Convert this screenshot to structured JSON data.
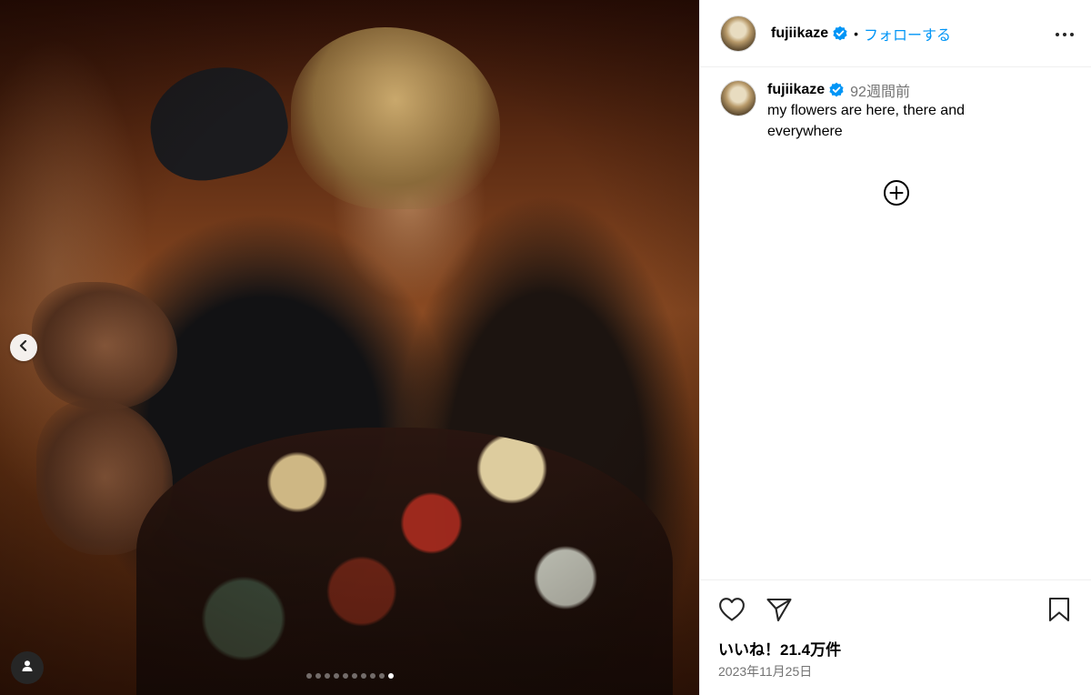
{
  "post": {
    "username": "fujiikaze",
    "follow_label": "フォローする",
    "separator": "•",
    "verified_icon": "verified-badge-icon",
    "more_icon": "more-options-icon"
  },
  "caption": {
    "username": "fujiikaze",
    "time_ago": "92週間前",
    "text": "my flowers are here, there and everywhere"
  },
  "carousel": {
    "dot_count": 10,
    "active_index": 9,
    "prev_icon": "chevron-left-icon",
    "user_tag_icon": "user-icon"
  },
  "actions": {
    "like_icon": "heart-icon",
    "share_icon": "paper-plane-icon",
    "save_icon": "bookmark-icon",
    "load_more_icon": "plus-circle-icon",
    "likes_text": "いいね！21.4万件",
    "date_text": "2023年11月25日"
  },
  "colors": {
    "accent_blue": "#0095f6",
    "secondary_text": "#737373",
    "border": "#efefef"
  }
}
